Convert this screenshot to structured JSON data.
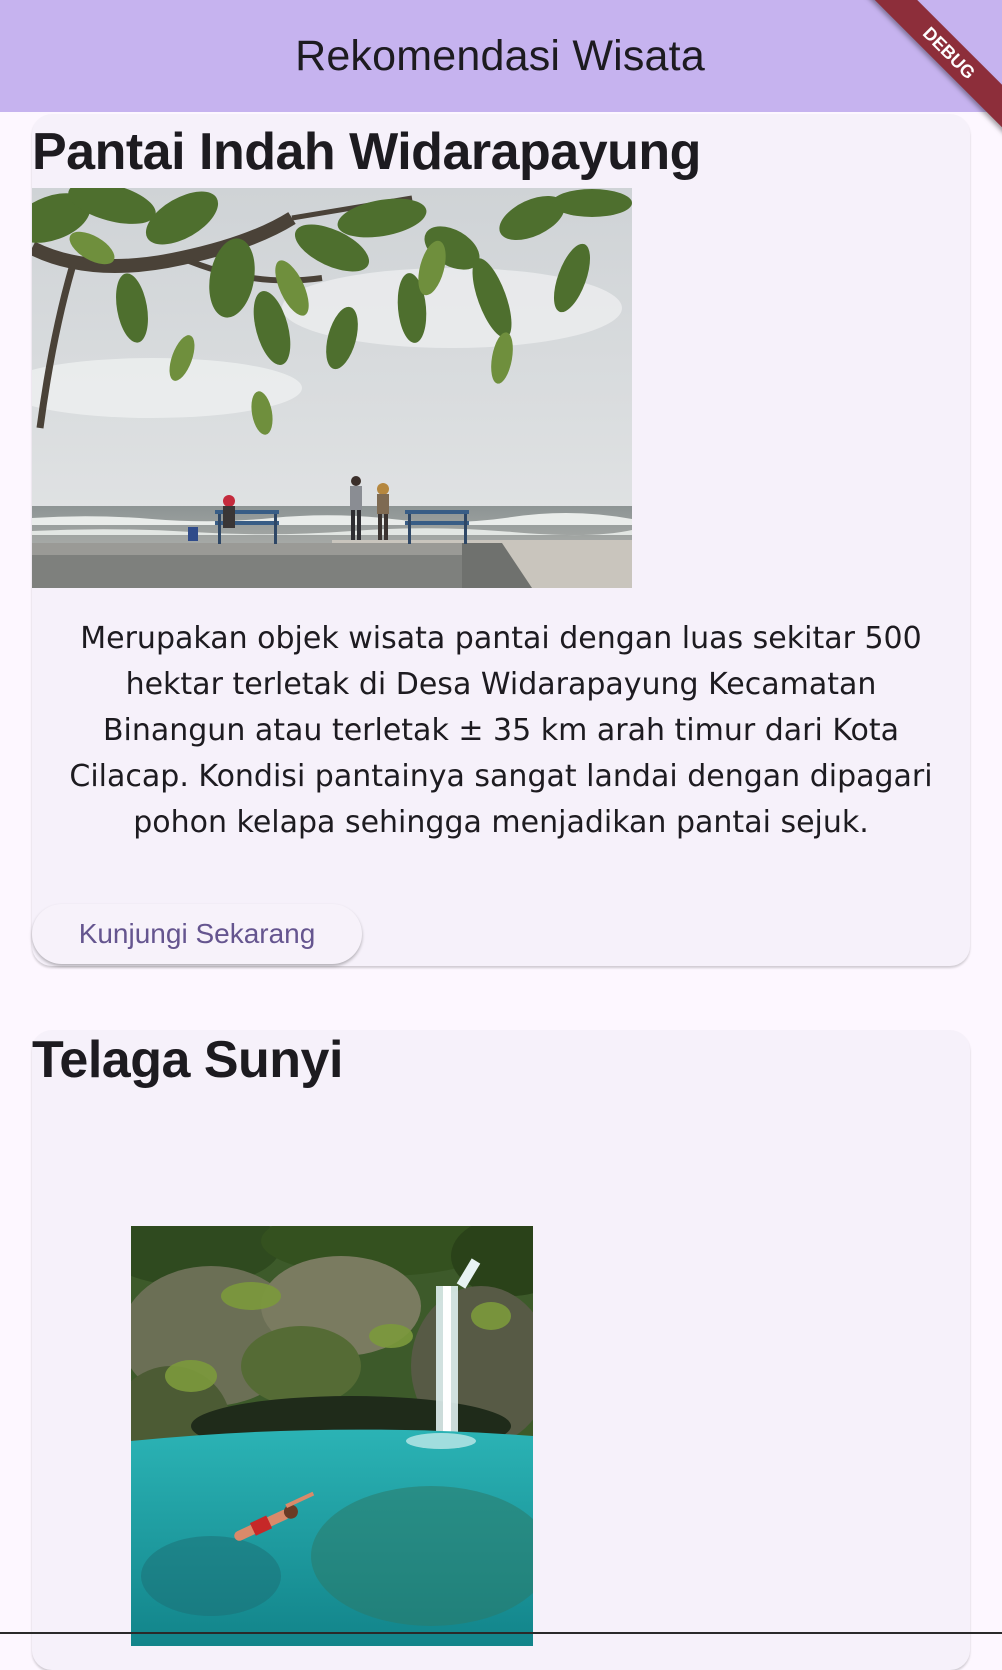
{
  "app_bar": {
    "title": "Rekomendasi Wisata",
    "debug_label": "DEBUG"
  },
  "colors": {
    "app_bar_background": "#c6b3ef",
    "page_background": "#fdf7ff",
    "card_background": "#f6f1fa",
    "button_text": "#65558f",
    "debug_ribbon": "#8d2e3a"
  },
  "destinations": [
    {
      "title": "Pantai Indah Widarapayung",
      "image_subject": "beach-photo",
      "description": "Merupakan objek wisata pantai dengan luas sekitar 500 hektar terletak di Desa Widarapayung Kecamatan Binangun atau terletak ± 35 km arah timur dari Kota Cilacap. Kondisi pantainya sangat landai dengan dipagari pohon kelapa sehingga menjadikan pantai sejuk.",
      "button_label": "Kunjungi Sekarang"
    },
    {
      "title": "Telaga Sunyi",
      "image_subject": "lake-waterfall-photo"
    }
  ]
}
